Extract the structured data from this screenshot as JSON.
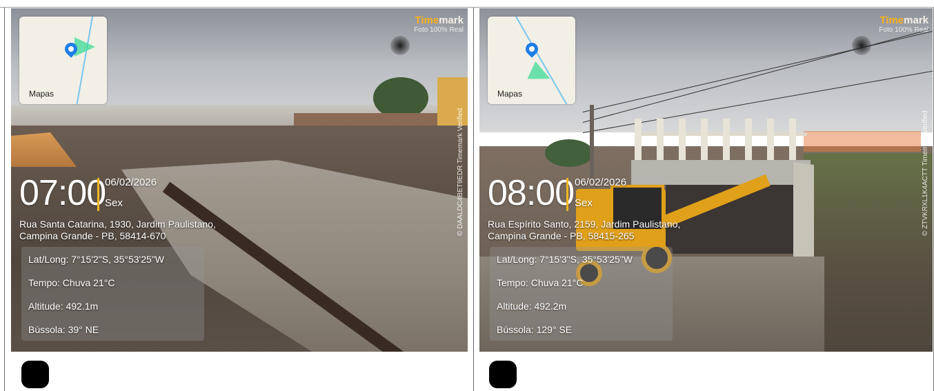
{
  "photos": [
    {
      "map_label": "Mapas",
      "brand_highlight": "Time",
      "brand_rest": "mark",
      "brand_sub": "Foto 100% Real",
      "verify_code": "© DAALDC4BET9EDR  Timemark Verified",
      "time": "07:00",
      "date": "06/02/2026",
      "day": "Sex",
      "address_line1": "Rua Santa Catarina, 1930, Jardim Paulistano,",
      "address_line2": "Campina Grande - PB, 58414-670",
      "latlong": "Lat/Long: 7°15'2\"S, 35°53'25\"W",
      "weather": "Tempo: Chuva 21°C",
      "altitude": "Altitude: 492.1m",
      "compass": "Bússola: 39° NE"
    },
    {
      "map_label": "Mapas",
      "brand_highlight": "Time",
      "brand_rest": "mark",
      "brand_sub": "Foto 100% Real",
      "verify_code": "© ZTVKRXL1K4ACTT  Timemark Verified",
      "time": "08:00",
      "date": "06/02/2026",
      "day": "Sex",
      "address_line1": "Rua Espírito Santo, 2159, Jardim Paulistano,",
      "address_line2": "Campina Grande - PB, 58415-265",
      "latlong": "Lat/Long: 7°15'3\"S, 35°53'25\"W",
      "weather": "Tempo: Chuva 21°C",
      "altitude": "Altitude: 492.2m",
      "compass": "Bússola: 129° SE"
    }
  ],
  "colors": {
    "accent": "#ffb11a",
    "divider": "#f5b724",
    "pin": "#1e7de6"
  },
  "icons": [
    "apple-maps-icon",
    "location-pin-icon",
    "heading-beam-icon"
  ]
}
